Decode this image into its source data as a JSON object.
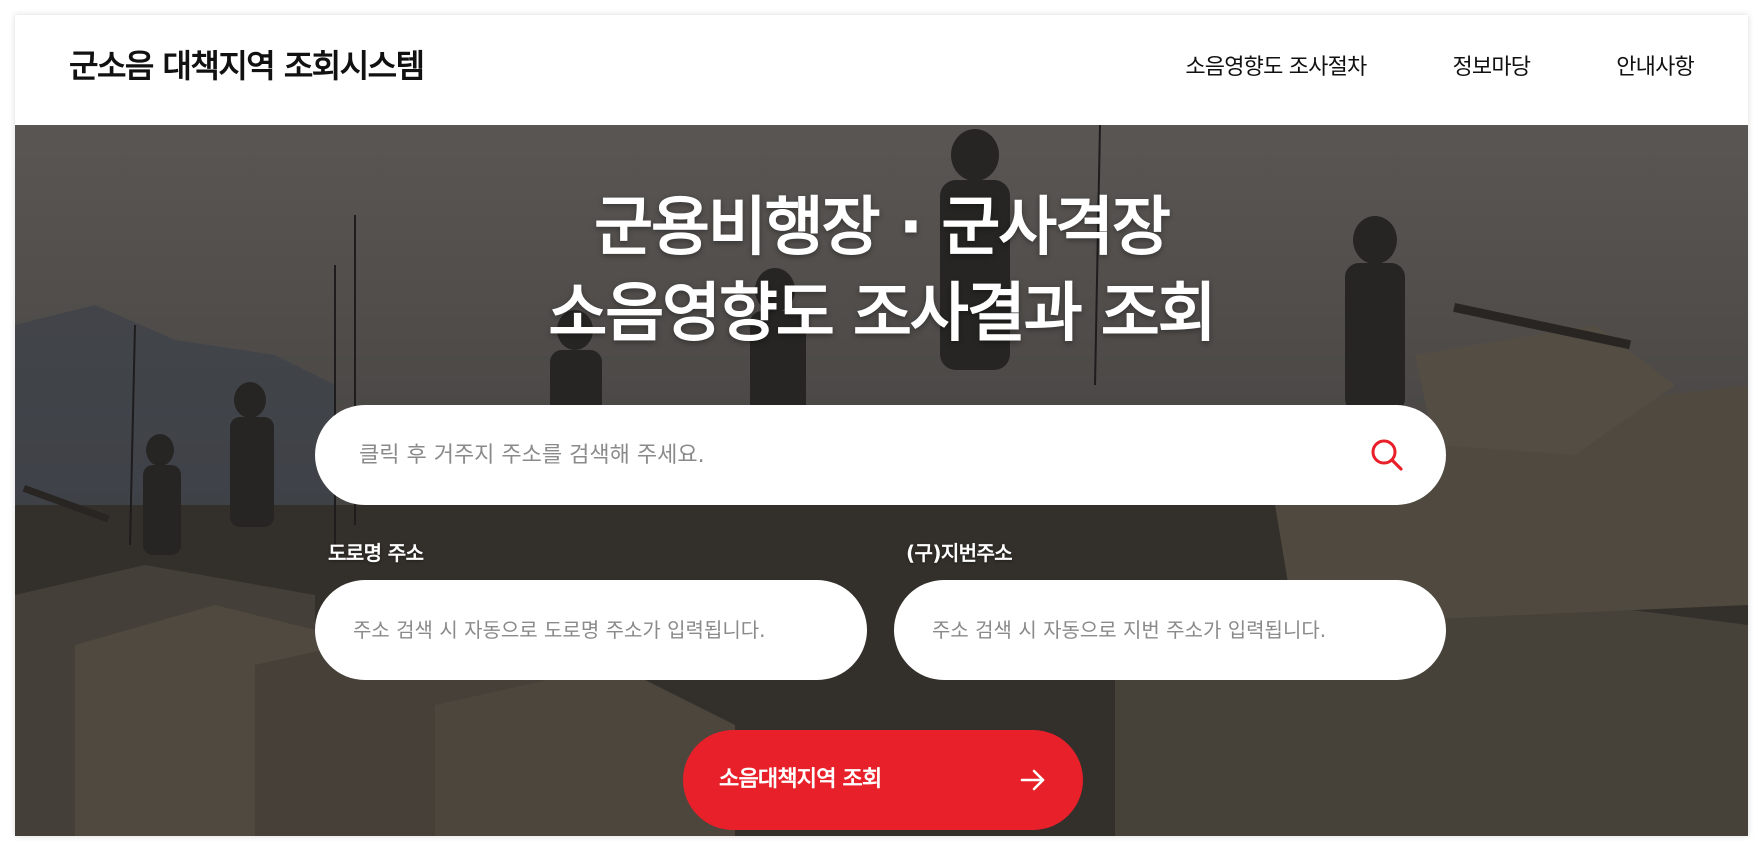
{
  "header": {
    "brand": "군소음 대책지역 조회시스템",
    "nav": [
      {
        "label": "소음영향도 조사절차"
      },
      {
        "label": "정보마당"
      },
      {
        "label": "안내사항"
      }
    ]
  },
  "hero": {
    "title_line1": "군용비행장 · 군사격장",
    "title_line2": "소음영향도 조사결과 조회",
    "search": {
      "placeholder": "클릭 후 거주지 주소를 검색해 주세요.",
      "value": ""
    },
    "road_address": {
      "label": "도로명 주소",
      "placeholder": "주소 검색 시 자동으로 도로명 주소가 입력됩니다."
    },
    "lot_address": {
      "label": "(구)지번주소",
      "placeholder": "주소 검색 시 자동으로 지번 주소가 입력됩니다."
    },
    "submit_label": "소음대책지역 조회"
  },
  "colors": {
    "accent": "#e8202a",
    "icon_red": "#e8202a",
    "text_dark": "#111111"
  },
  "icons": {
    "search": "search-icon",
    "arrow": "arrow-right-icon"
  }
}
